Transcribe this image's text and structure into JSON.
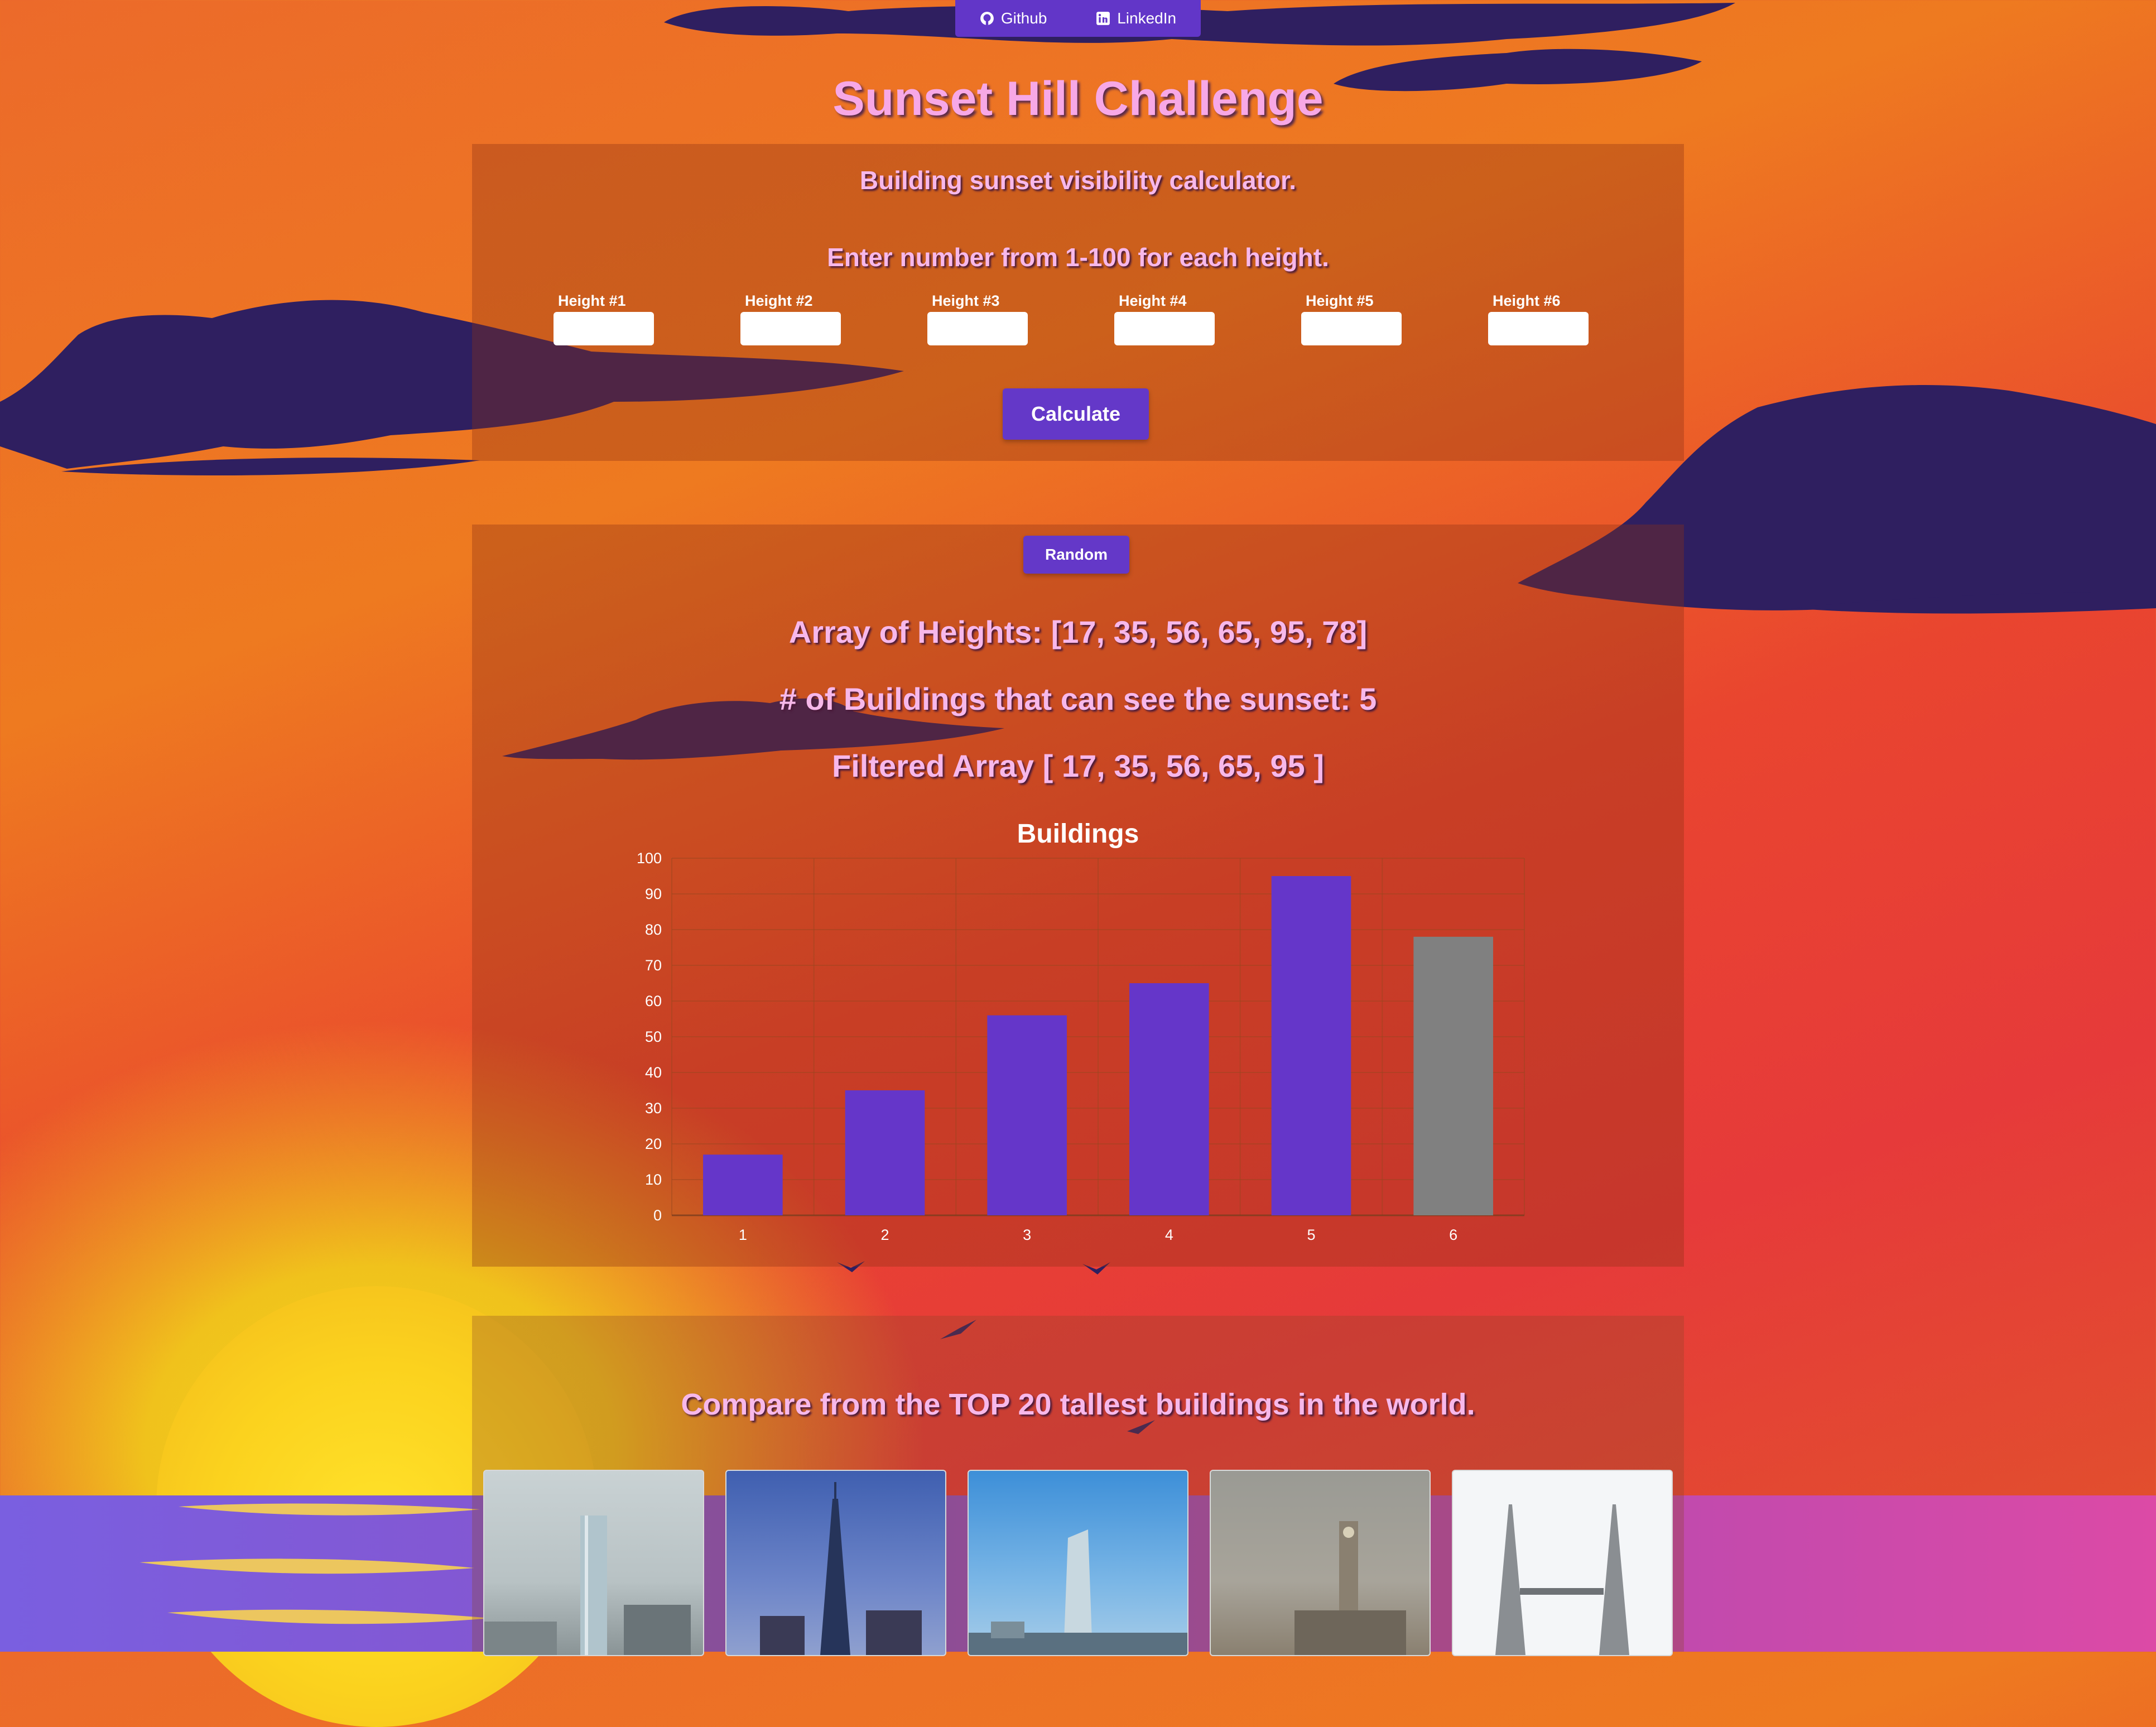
{
  "nav": {
    "github_label": "Github",
    "linkedin_label": "LinkedIn"
  },
  "header": {
    "title": "Sunset Hill Challenge"
  },
  "calculator": {
    "subtitle": "Building sunset visibility calculator.",
    "instruction": "Enter number from 1-100 for each height.",
    "fields": [
      {
        "label": "Height #1",
        "value": ""
      },
      {
        "label": "Height #2",
        "value": ""
      },
      {
        "label": "Height #3",
        "value": ""
      },
      {
        "label": "Height #4",
        "value": ""
      },
      {
        "label": "Height #5",
        "value": ""
      },
      {
        "label": "Height #6",
        "value": ""
      }
    ],
    "calculate_label": "Calculate"
  },
  "results": {
    "random_label": "Random",
    "array_text": "Array of Heights: [17, 35, 56, 65, 95, 78]",
    "count_text": "# of Buildings that can see the sunset: 5",
    "filtered_text": "Filtered Array [ 17, 35, 56, 65, 95 ]"
  },
  "chart_data": {
    "type": "bar",
    "title": "Buildings",
    "categories": [
      "1",
      "2",
      "3",
      "4",
      "5",
      "6"
    ],
    "values": [
      17,
      35,
      56,
      65,
      95,
      78
    ],
    "can_see_sunset": [
      true,
      true,
      true,
      true,
      true,
      false
    ],
    "ylim": [
      0,
      100
    ],
    "yticks": [
      0,
      10,
      20,
      30,
      40,
      50,
      60,
      70,
      80,
      90,
      100
    ],
    "grid": true,
    "colors": {
      "visible": "#6536c9",
      "blocked": "#808080"
    }
  },
  "compare": {
    "heading": "Compare from the TOP 20 tallest buildings in the world.",
    "buildings": [
      {
        "icon": "skyscraper-photo-1"
      },
      {
        "icon": "skyscraper-photo-2"
      },
      {
        "icon": "skyscraper-photo-3"
      },
      {
        "icon": "clock-tower-photo"
      },
      {
        "icon": "twin-towers-photo"
      }
    ]
  },
  "colors": {
    "accent": "#6438c8",
    "title_pink": "#f7a8e6",
    "cloud": "#2f1f60"
  }
}
